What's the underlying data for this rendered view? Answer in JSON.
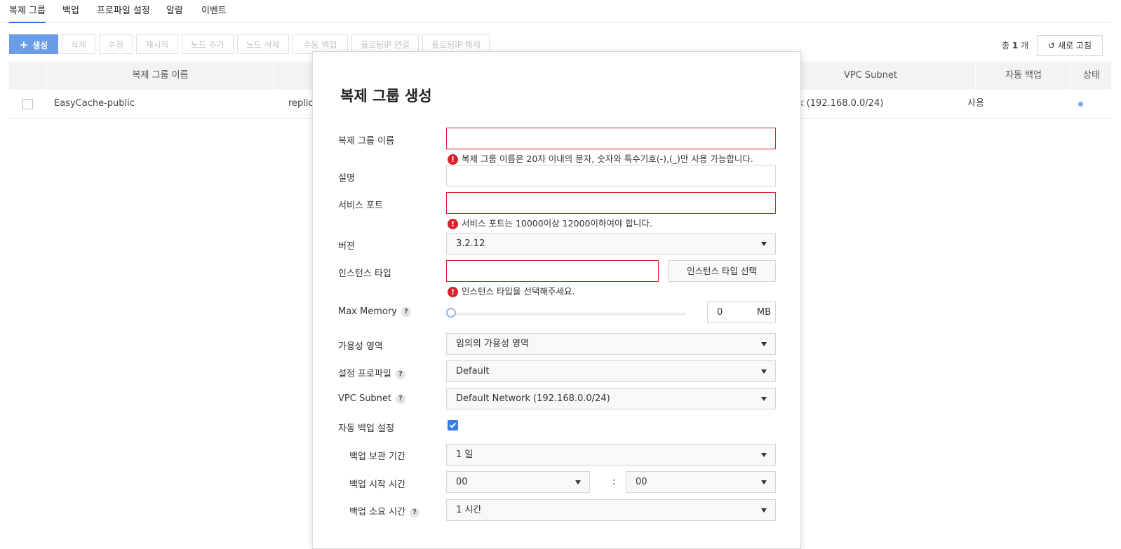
{
  "tabs": [
    "복제 그룹",
    "백업",
    "프로파일 설정",
    "알람",
    "이벤트"
  ],
  "toolbar": {
    "buttons": [
      "생성",
      "삭제",
      "수정",
      "재시작",
      "노드 추가",
      "노드 삭제",
      "수동 백업",
      "플로팅IP 연결",
      "플로팅IP 해제"
    ],
    "total_prefix": "총",
    "total_count": "1",
    "total_suffix": "개",
    "refresh": "새로 고침"
  },
  "table": {
    "columns": [
      "복제 그룹 이름",
      "VPC Subnet",
      "자동 백업",
      "상태"
    ],
    "rows": [
      {
        "name": "EasyCache-public",
        "mid": "replica",
        "subnet": "k (192.168.0.0/24)",
        "backup": "사용"
      }
    ]
  },
  "modal": {
    "title": "복제 그룹 생성",
    "fields": {
      "group_name": {
        "label": "복제 그룹 이름",
        "error": "복제 그룹 이름은 20자 이내의 문자, 숫자와 특수기호(-),(_)만 사용 가능합니다."
      },
      "description": {
        "label": "설명"
      },
      "port": {
        "label": "서비스 포트",
        "error": "서비스 포트는 10000이상 12000이하여야 합니다."
      },
      "version": {
        "label": "버젼",
        "value": "3.2.12"
      },
      "instance_type": {
        "label": "인스턴스 타입",
        "button": "인스턴스 타입 선택",
        "error": "인스턴스 타입을 선택해주세요."
      },
      "max_memory": {
        "label": "Max Memory",
        "value": "0",
        "unit": "MB",
        "level": 0
      },
      "az": {
        "label": "가용성 영역",
        "value": "임의의 가용성 영역"
      },
      "profile": {
        "label": "설정 프로파일",
        "value": "Default"
      },
      "vpc": {
        "label": "VPC Subnet",
        "value": "Default Network (192.168.0.0/24)"
      },
      "auto_backup": {
        "label": "자동 백업 설정",
        "checked": true
      },
      "retention": {
        "label": "백업 보관 기간",
        "value": "1 일"
      },
      "start_time": {
        "label": "백업 시작 시간",
        "hour": "00",
        "minute": "00",
        "sep": ":"
      },
      "duration": {
        "label": "백업 소요 시간",
        "value": "1 시간"
      }
    },
    "help_glyph": "?",
    "error_glyph": "!"
  }
}
